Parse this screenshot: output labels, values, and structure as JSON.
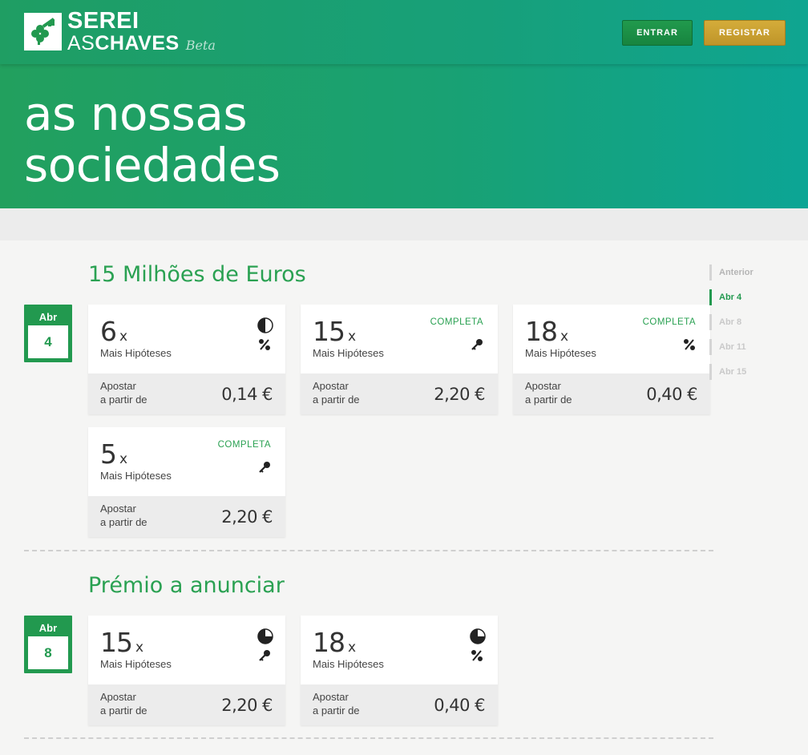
{
  "header": {
    "logo_line1": "SEREI",
    "logo_line2_thin": "AS",
    "logo_line2_bold": "CHAVES",
    "logo_beta": "Beta",
    "login_label": "ENTRAR",
    "register_label": "REGISTAR"
  },
  "hero": {
    "title_line1": "as nossas",
    "title_line2": "sociedades"
  },
  "colors": {
    "brand_green": "#22994f",
    "accent_gold": "#c9a032",
    "text_green": "#2aa152"
  },
  "timeline": [
    {
      "label": "Anterior",
      "state": "anterior"
    },
    {
      "label": "Abr 4",
      "state": "active"
    },
    {
      "label": "Abr 8",
      "state": "inactive"
    },
    {
      "label": "Abr 11",
      "state": "inactive"
    },
    {
      "label": "Abr 15",
      "state": "inactive"
    }
  ],
  "sections": [
    {
      "title": "15 Milhões de Euros",
      "date": {
        "month": "Abr",
        "day": "4"
      },
      "cards": [
        {
          "multiplier": "6",
          "x": "x",
          "subtitle": "Mais Hipóteses",
          "status": "",
          "icons": [
            "half-pie-icon",
            "percent-icon"
          ],
          "from_line1": "Apostar",
          "from_line2": "a partir de",
          "price": "0,14 €"
        },
        {
          "multiplier": "15",
          "x": "x",
          "subtitle": "Mais Hipóteses",
          "status": "COMPLETA",
          "icons": [
            "key-icon"
          ],
          "from_line1": "Apostar",
          "from_line2": "a partir de",
          "price": "2,20 €"
        },
        {
          "multiplier": "18",
          "x": "x",
          "subtitle": "Mais Hipóteses",
          "status": "COMPLETA",
          "icons": [
            "percent-icon"
          ],
          "from_line1": "Apostar",
          "from_line2": "a partir de",
          "price": "0,40 €"
        },
        {
          "multiplier": "5",
          "x": "x",
          "subtitle": "Mais Hipóteses",
          "status": "COMPLETA",
          "icons": [
            "key-icon"
          ],
          "from_line1": "Apostar",
          "from_line2": "a partir de",
          "price": "2,20 €"
        }
      ]
    },
    {
      "title": "Prémio a anunciar",
      "date": {
        "month": "Abr",
        "day": "8"
      },
      "cards": [
        {
          "multiplier": "15",
          "x": "x",
          "subtitle": "Mais Hipóteses",
          "status": "",
          "icons": [
            "three-quarter-pie-icon",
            "key-icon"
          ],
          "from_line1": "Apostar",
          "from_line2": "a partir de",
          "price": "2,20 €"
        },
        {
          "multiplier": "18",
          "x": "x",
          "subtitle": "Mais Hipóteses",
          "status": "",
          "icons": [
            "three-quarter-pie-icon",
            "percent-icon"
          ],
          "from_line1": "Apostar",
          "from_line2": "a partir de",
          "price": "0,40 €"
        }
      ]
    }
  ]
}
